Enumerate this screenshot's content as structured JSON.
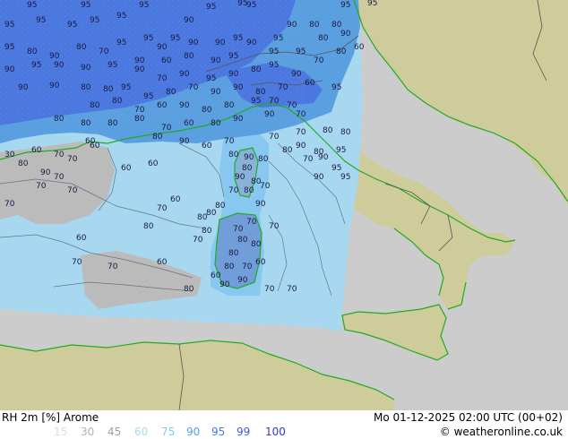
{
  "footer": {
    "title": "RH 2m [%] Arome",
    "valid_time": "Mo 01-12-2025 02:00 UTC (00+02)",
    "copyright": "© weatheronline.co.uk"
  },
  "legend": [
    {
      "label": "15",
      "color": "#dcdcdc"
    },
    {
      "label": "30",
      "color": "#b4b4b4"
    },
    {
      "label": "45",
      "color": "#a0a0a0"
    },
    {
      "label": "60",
      "color": "#a8d8f0"
    },
    {
      "label": "75",
      "color": "#88c8f0"
    },
    {
      "label": "90",
      "color": "#5aa0e0"
    },
    {
      "label": "95",
      "color": "#4a78e0"
    },
    {
      "label": "99",
      "color": "#3c5ad8"
    },
    {
      "label": "100",
      "color": "#2a3cc8"
    }
  ],
  "colors": {
    "land_outside": "#cdcc9a",
    "sea_outside": "#cccccc",
    "rh_60_75": "#a8d8f0",
    "rh_75_90": "#88c8f0",
    "rh_90_95": "#5aa0e0",
    "rh_95_99": "#4a78e0",
    "rh_low": "#bbbbbb",
    "coast": "#22aa22",
    "border": "#555555",
    "isoline": "#506070"
  },
  "map_labels": [
    "95",
    "95",
    "95",
    "95",
    "95",
    "95",
    "95",
    "95",
    "95",
    "95",
    "95",
    "95",
    "95",
    "90",
    "95",
    "95",
    "90",
    "95",
    "90",
    "90",
    "95",
    "90",
    "95",
    "90",
    "80",
    "80",
    "95",
    "80",
    "90",
    "80",
    "70",
    "90",
    "60",
    "80",
    "90",
    "95",
    "95",
    "95",
    "80",
    "90",
    "90",
    "95",
    "90",
    "90",
    "95",
    "90",
    "70",
    "90",
    "95",
    "90",
    "80",
    "95",
    "90",
    "70",
    "80",
    "60",
    "90",
    "90",
    "80",
    "80",
    "95",
    "95",
    "80",
    "70",
    "90",
    "90",
    "80",
    "70",
    "60",
    "95",
    "80",
    "80",
    "70",
    "60",
    "90",
    "80",
    "80",
    "95",
    "70",
    "70",
    "80",
    "80",
    "80",
    "80",
    "70",
    "60",
    "80",
    "90",
    "90",
    "70",
    "80",
    "90",
    "60",
    "70",
    "70",
    "70",
    "80",
    "80",
    "80",
    "90",
    "80",
    "80",
    "90",
    "80",
    "80",
    "90",
    "80",
    "70",
    "80",
    "70",
    "70",
    "90",
    "95",
    "95",
    "90",
    "95",
    "90",
    "70",
    "70",
    "70",
    "80",
    "80",
    "80",
    "60",
    "70",
    "90",
    "90",
    "60",
    "80",
    "70",
    "30",
    "60",
    "90",
    "70",
    "60",
    "60",
    "80",
    "70",
    "70",
    "70",
    "70",
    "60",
    "60",
    "60",
    "70",
    "80",
    "80",
    "80",
    "80",
    "70",
    "80",
    "60",
    "70",
    "70",
    "60",
    "80",
    "70",
    "70"
  ]
}
